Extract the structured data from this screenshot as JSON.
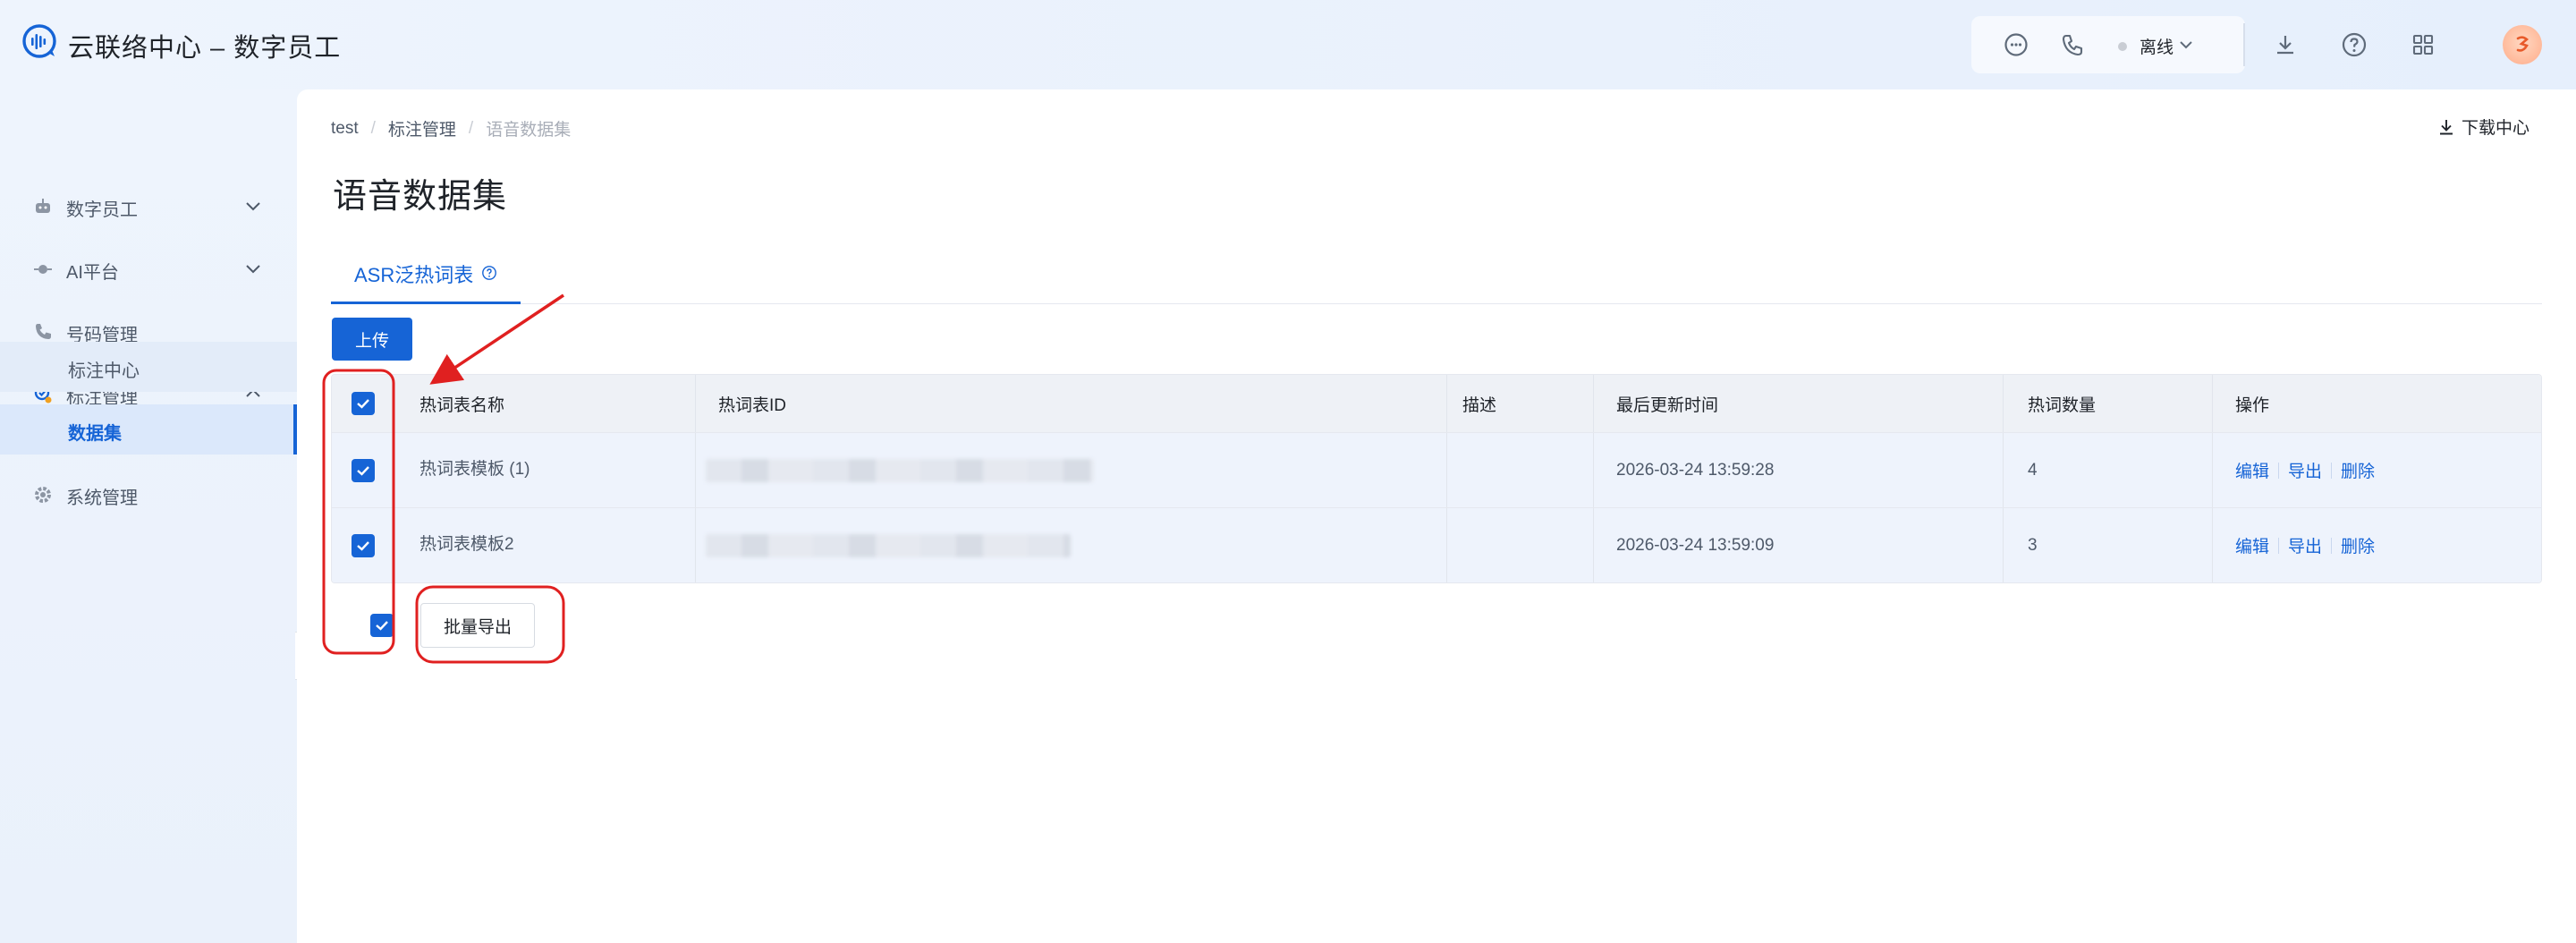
{
  "app": {
    "title": "云联络中心 – 数字员工"
  },
  "header": {
    "status_label": "离线",
    "icons": [
      "message-icon",
      "phone-icon",
      "download-icon",
      "help-icon",
      "apps-grid-icon"
    ],
    "avatar_icon": "user-avatar"
  },
  "sidebar": {
    "items": [
      {
        "label": "数字员工",
        "icon": "robot-icon",
        "expanded": false
      },
      {
        "label": "AI平台",
        "icon": "ai-icon",
        "expanded": false
      },
      {
        "label": "号码管理",
        "icon": "phone-icon",
        "expanded": false
      },
      {
        "label": "标注管理",
        "icon": "annotation-icon",
        "expanded": true
      },
      {
        "label": "系统管理",
        "icon": "gear-icon",
        "expanded": false
      }
    ],
    "sub_items": [
      {
        "label": "标注中心",
        "selected": false
      },
      {
        "label": "数据集",
        "selected": true
      }
    ]
  },
  "breadcrumb": {
    "items": [
      "test",
      "标注管理",
      "语音数据集"
    ]
  },
  "download_center": "下载中心",
  "page_title": "语音数据集",
  "tabs": [
    {
      "label": "ASR泛热词表",
      "active": true
    }
  ],
  "upload_label": "上传",
  "table": {
    "columns": [
      "热词表名称",
      "热词表ID",
      "描述",
      "最后更新时间",
      "热词数量",
      "操作"
    ],
    "rows": [
      {
        "name": "热词表模板 (1)",
        "id": "",
        "desc": "",
        "updated": "2026-03-24 13:59:28",
        "count": "4",
        "checked": true
      },
      {
        "name": "热词表模板2",
        "id": "",
        "desc": "",
        "updated": "2026-03-24 13:59:09",
        "count": "3",
        "checked": true
      }
    ],
    "actions": {
      "edit": "编辑",
      "export": "导出",
      "delete": "删除"
    },
    "select_all_checked": true
  },
  "batch_export_label": "批量导出",
  "colors": {
    "primary": "#1664d6",
    "annotation": "#e02020"
  }
}
